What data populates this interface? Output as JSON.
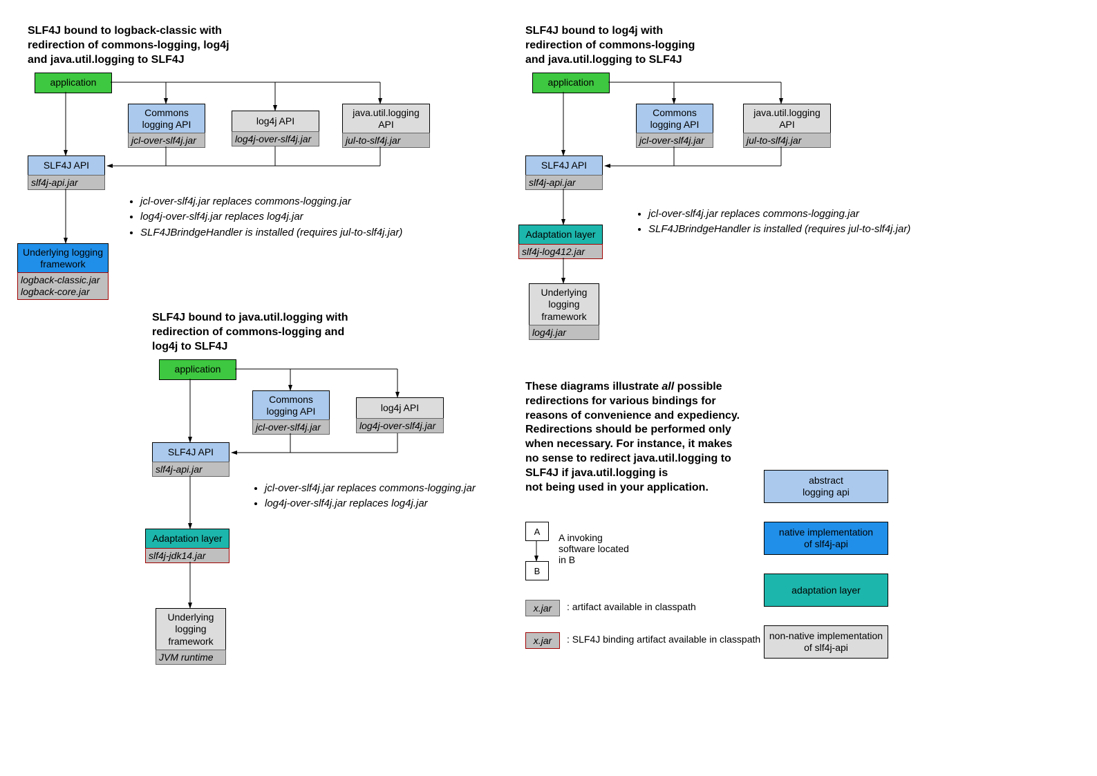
{
  "d1": {
    "title": "SLF4J bound to logback-classic with\nredirection of commons-logging, log4j\nand java.util.logging to SLF4J",
    "app": "application",
    "commons": "Commons\nlogging API",
    "commons_jar": "jcl-over-slf4j.jar",
    "log4j": "log4j API",
    "log4j_jar": "log4j-over-slf4j.jar",
    "jul": "java.util.logging\nAPI",
    "jul_jar": "jul-to-slf4j.jar",
    "api": "SLF4J API",
    "api_jar": "slf4j-api.jar",
    "fw": "Underlying logging\nframework",
    "fw_jar": "logback-classic.jar\nlogback-core.jar",
    "notes": [
      "jcl-over-slf4j.jar replaces commons-logging.jar",
      "log4j-over-slf4j.jar replaces log4j.jar",
      "SLF4JBrindgeHandler is installed (requires jul-to-slf4j.jar)"
    ]
  },
  "d2": {
    "title": "SLF4J bound to java.util.logging with\nredirection of commons-logging and\nlog4j to SLF4J",
    "app": "application",
    "commons": "Commons\nlogging API",
    "commons_jar": "jcl-over-slf4j.jar",
    "log4j": "log4j API",
    "log4j_jar": "log4j-over-slf4j.jar",
    "api": "SLF4J API",
    "api_jar": "slf4j-api.jar",
    "adapt": "Adaptation layer",
    "adapt_jar": "slf4j-jdk14.jar",
    "fw": "Underlying\nlogging\nframework",
    "fw_jar": "JVM runtime",
    "notes": [
      "jcl-over-slf4j.jar replaces commons-logging.jar",
      "log4j-over-slf4j.jar replaces log4j.jar"
    ]
  },
  "d3": {
    "title": "SLF4J bound to log4j with\nredirection of commons-logging\nand java.util.logging to SLF4J",
    "app": "application",
    "commons": "Commons\nlogging API",
    "commons_jar": "jcl-over-slf4j.jar",
    "jul": "java.util.logging\nAPI",
    "jul_jar": "jul-to-slf4j.jar",
    "api": "SLF4J API",
    "api_jar": "slf4j-api.jar",
    "adapt": "Adaptation layer",
    "adapt_jar": "slf4j-log412.jar",
    "fw": "Underlying\nlogging\nframework",
    "fw_jar": "log4j.jar",
    "notes": [
      "jcl-over-slf4j.jar replaces commons-logging.jar",
      "SLF4JBrindgeHandler is installed (requires jul-to-slf4j.jar)"
    ]
  },
  "expl": "These diagrams illustrate <i>all</i> possible\nredirections for various bindings for\nreasons of convenience and expediency.\nRedirections should be performed only\nwhen necessary. For instance, it makes\nno sense to redirect java.util.logging to\nSLF4J if java.util.logging is\nnot being used in your application.",
  "key": {
    "a": "A",
    "b": "B",
    "ab_txt": "A invoking\nsoftware located\nin B",
    "jar1": "x.jar",
    "jar1_txt": ": artifact available in classpath",
    "jar2": "x.jar",
    "jar2_txt": ": SLF4J binding artifact available in classpath",
    "l1": "abstract\nlogging api",
    "l2": "native implementation\nof slf4j-api",
    "l3": "adaptation layer",
    "l4": "non-native implementation\nof slf4j-api"
  }
}
